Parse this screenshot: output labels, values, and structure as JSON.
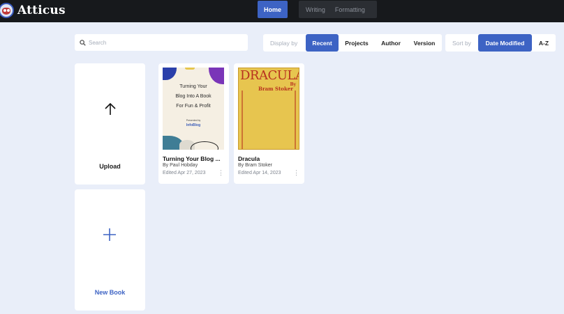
{
  "app": {
    "name": "Atticus"
  },
  "nav": {
    "home": "Home",
    "writing": "Writing",
    "formatting": "Formatting"
  },
  "search": {
    "placeholder": "Search"
  },
  "display_by": {
    "label": "Display by",
    "options": [
      "Recent",
      "Projects",
      "Author",
      "Version"
    ],
    "selected": "Recent"
  },
  "sort_by": {
    "label": "Sort by",
    "options": [
      "Date Modified",
      "A-Z"
    ],
    "selected": "Date Modified"
  },
  "actions": {
    "upload": "Upload",
    "new_book": "New Book"
  },
  "books": [
    {
      "title": "Turning Your Blog ...",
      "author": "By Paul Hobday",
      "edited": "Edited Apr 27, 2023",
      "cover_lines": [
        "Turning Your",
        "Blog Into A Book",
        "For Fun & Profit"
      ],
      "cover_small": "Presented by",
      "cover_brand": "InfoBlog"
    },
    {
      "title": "Dracula",
      "author": "By Bram Stoker",
      "edited": "Edited Apr 14, 2023",
      "cover_title": "DRACULA",
      "cover_by": "By",
      "cover_author": "Bram Stoker"
    }
  ],
  "colors": {
    "accent": "#3d63c4",
    "background": "#e9eef9",
    "topbar": "#17191c"
  }
}
